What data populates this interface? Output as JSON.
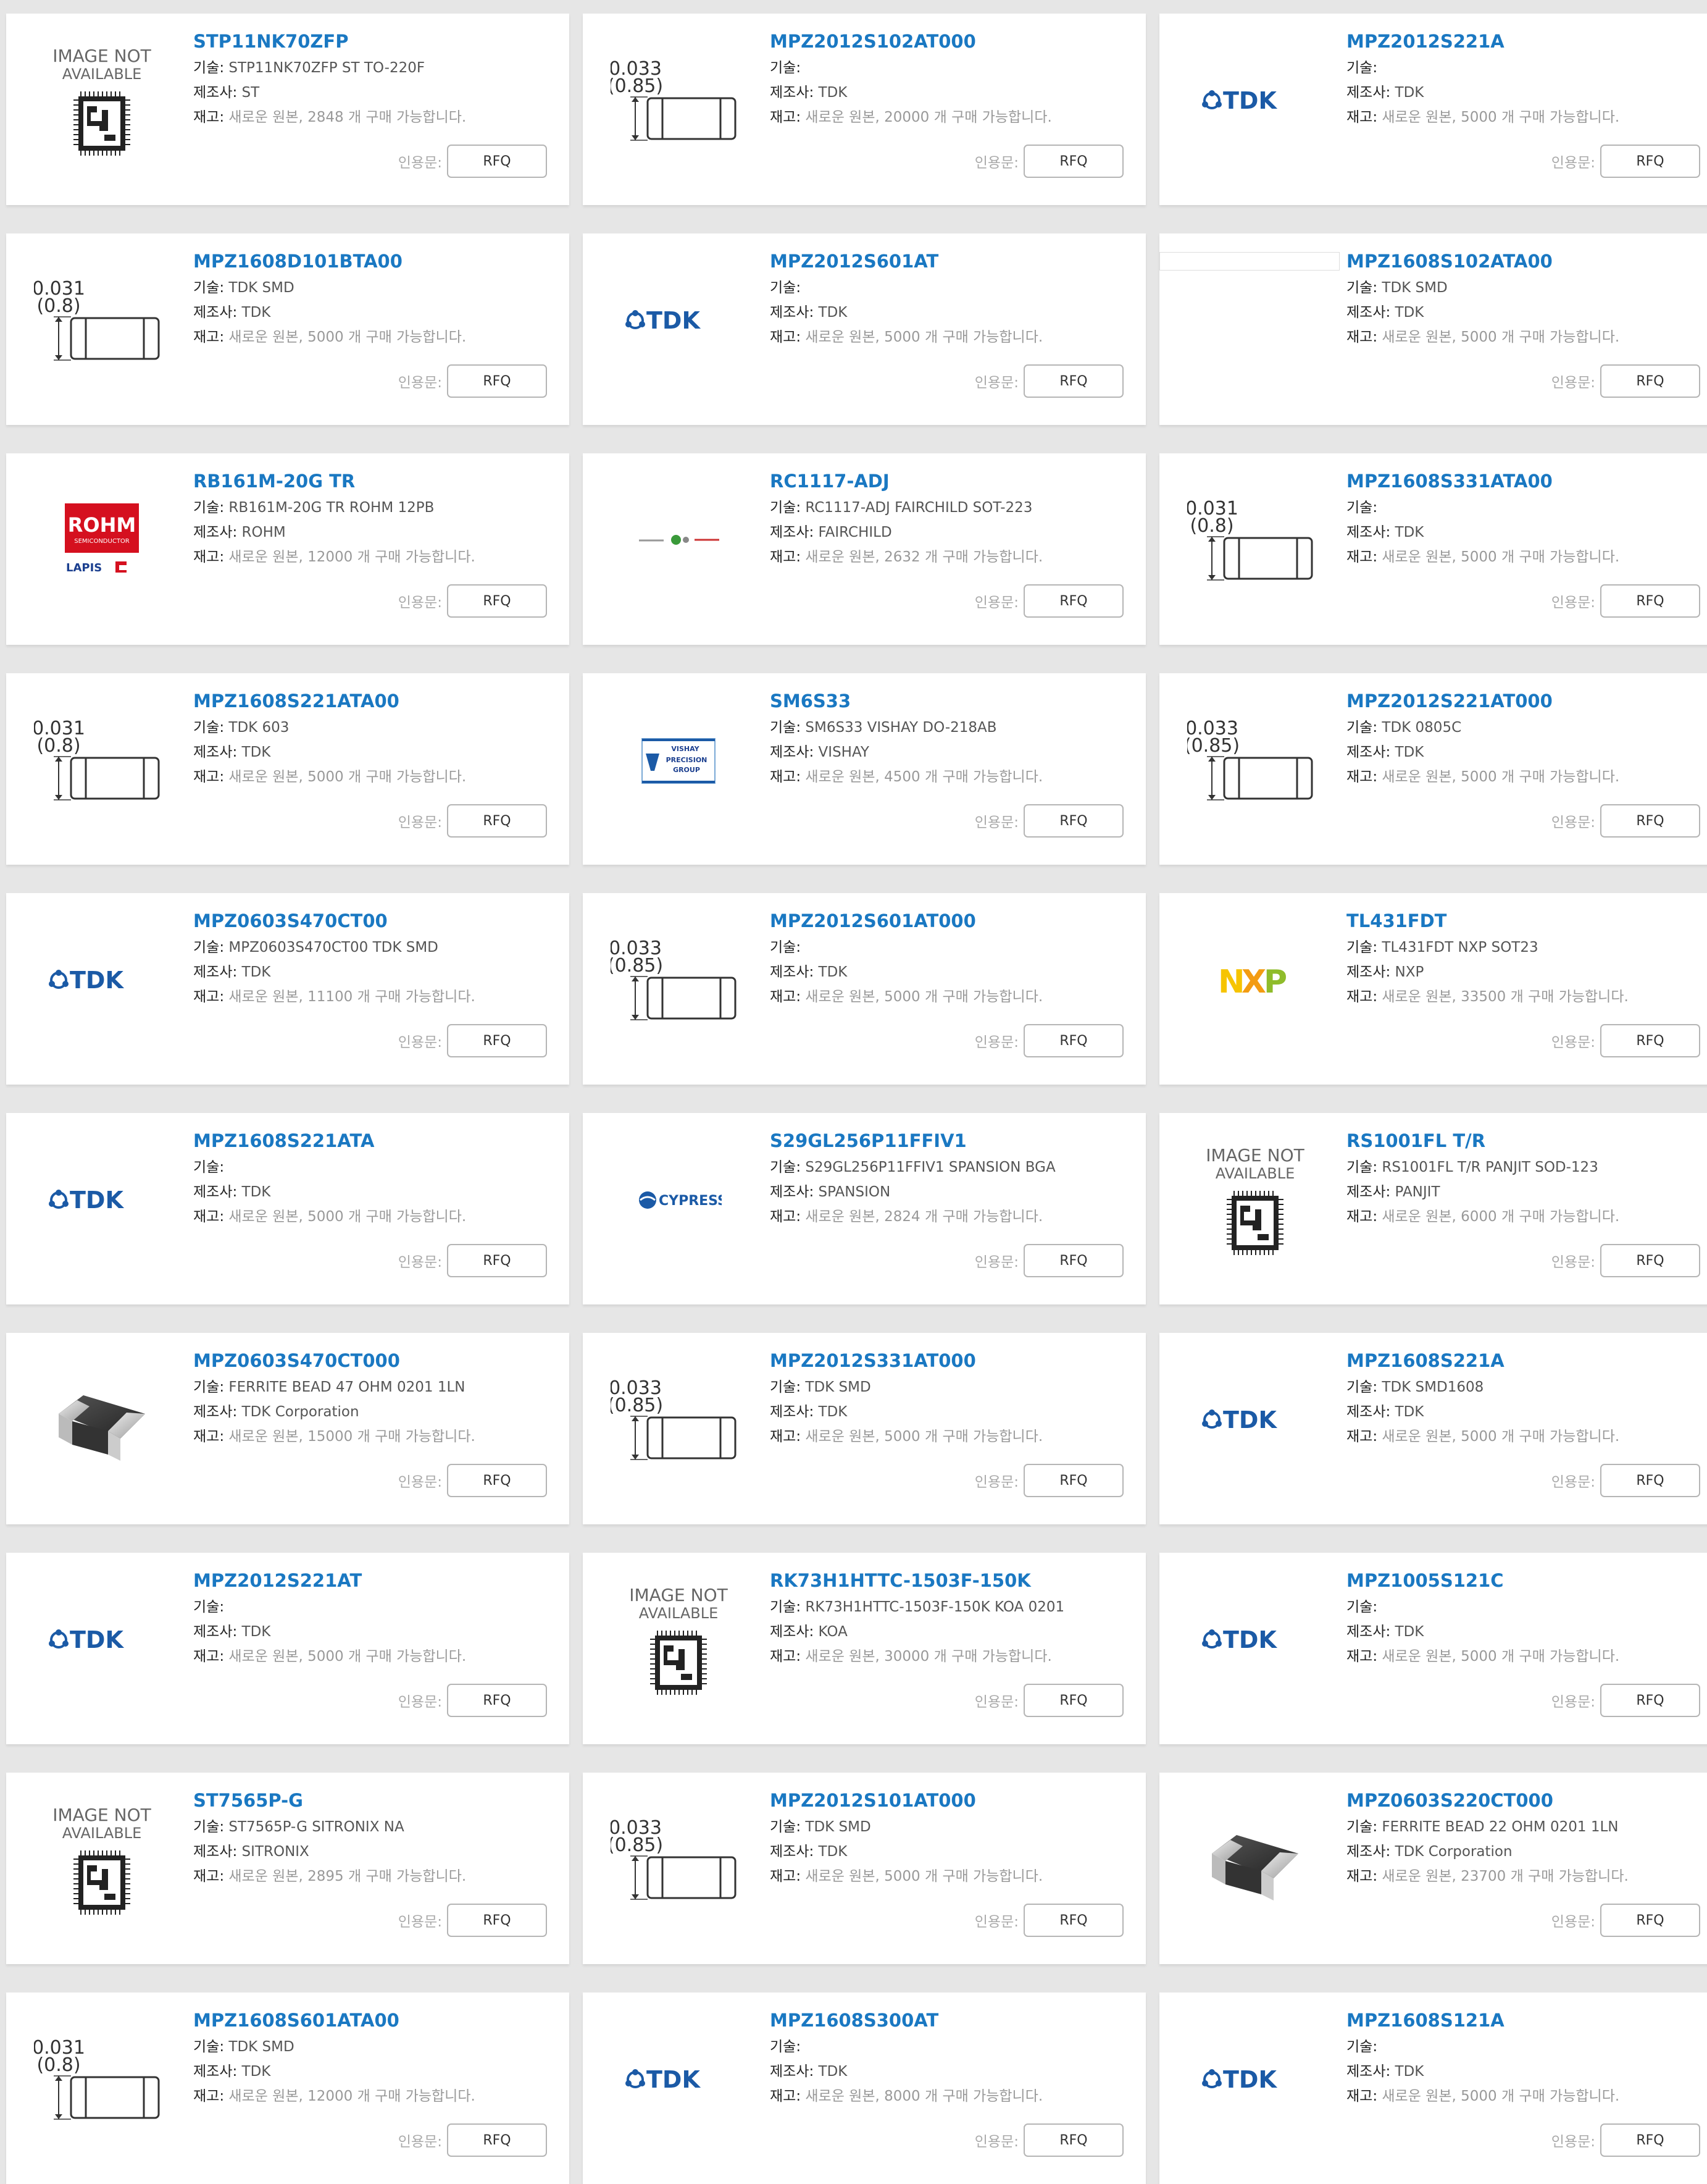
{
  "labels": {
    "tech": "기술:",
    "mfr": "제조사:",
    "stock": "재고:",
    "quote": "인용문:"
  },
  "products": [
    {
      "name": "STP11NK70ZFP",
      "tech": "STP11NK70ZFP ST TO-220F",
      "mfr": "ST",
      "stock": "새로운 원본, 2848 개 구매 가능합니다.",
      "rfq": "RFQ",
      "img": "noimage"
    },
    {
      "name": "MPZ2012S102AT000",
      "tech": "",
      "mfr": "TDK",
      "stock": "새로운 원본, 20000 개 구매 가능합니다.",
      "rfq": "RFQ",
      "img": "dim085"
    },
    {
      "name": "MPZ2012S221A",
      "tech": "",
      "mfr": "TDK",
      "stock": "새로운 원본, 5000 개 구매 가능합니다.",
      "rfq": "RFQ",
      "img": "tdk"
    },
    {
      "name": "MPZ1608D101BTA00",
      "tech": "TDK SMD",
      "mfr": "TDK",
      "stock": "새로운 원본, 5000 개 구매 가능합니다.",
      "rfq": "RFQ",
      "img": "dim08"
    },
    {
      "name": "MPZ2012S601AT",
      "tech": "",
      "mfr": "TDK",
      "stock": "새로운 원본, 5000 개 구매 가능합니다.",
      "rfq": "RFQ",
      "img": "tdk"
    },
    {
      "name": "MPZ1608S102ATA00",
      "tech": "TDK SMD",
      "mfr": "TDK",
      "stock": "새로운 원본, 5000 개 구매 가능합니다.",
      "rfq": "RFQ",
      "img": "blank"
    },
    {
      "name": "RB161M-20G TR",
      "tech": "RB161M-20G TR ROHM 12PB",
      "mfr": "ROHM",
      "stock": "새로운 원본, 12000 개 구매 가능합니다.",
      "rfq": "RFQ",
      "img": "rohm"
    },
    {
      "name": "RC1117-ADJ",
      "tech": "RC1117-ADJ FAIRCHILD SOT-223",
      "mfr": "FAIRCHILD",
      "stock": "새로운 원본, 2632 개 구매 가능합니다.",
      "rfq": "RFQ",
      "img": "fairchild"
    },
    {
      "name": "MPZ1608S331ATA00",
      "tech": "",
      "mfr": "TDK",
      "stock": "새로운 원본, 5000 개 구매 가능합니다.",
      "rfq": "RFQ",
      "img": "dim08"
    },
    {
      "name": "MPZ1608S221ATA00",
      "tech": "TDK 603",
      "mfr": "TDK",
      "stock": "새로운 원본, 5000 개 구매 가능합니다.",
      "rfq": "RFQ",
      "img": "dim08"
    },
    {
      "name": "SM6S33",
      "tech": "SM6S33 VISHAY DO-218AB",
      "mfr": "VISHAY",
      "stock": "새로운 원본, 4500 개 구매 가능합니다.",
      "rfq": "RFQ",
      "img": "vishay"
    },
    {
      "name": "MPZ2012S221AT000",
      "tech": "TDK 0805C",
      "mfr": "TDK",
      "stock": "새로운 원본, 5000 개 구매 가능합니다.",
      "rfq": "RFQ",
      "img": "dim085"
    },
    {
      "name": "MPZ0603S470CT00",
      "tech": "MPZ0603S470CT00 TDK SMD",
      "mfr": "TDK",
      "stock": "새로운 원본, 11100 개 구매 가능합니다.",
      "rfq": "RFQ",
      "img": "tdk"
    },
    {
      "name": "MPZ2012S601AT000",
      "tech": "",
      "mfr": "TDK",
      "stock": "새로운 원본, 5000 개 구매 가능합니다.",
      "rfq": "RFQ",
      "img": "dim085"
    },
    {
      "name": "TL431FDT",
      "tech": "TL431FDT NXP SOT23",
      "mfr": "NXP",
      "stock": "새로운 원본, 33500 개 구매 가능합니다.",
      "rfq": "RFQ",
      "img": "nxp"
    },
    {
      "name": "MPZ1608S221ATA",
      "tech": "",
      "mfr": "TDK",
      "stock": "새로운 원본, 5000 개 구매 가능합니다.",
      "rfq": "RFQ",
      "img": "tdk"
    },
    {
      "name": "S29GL256P11FFIV1",
      "tech": "S29GL256P11FFIV1 SPANSION BGA",
      "mfr": "SPANSION",
      "stock": "새로운 원본, 2824 개 구매 가능합니다.",
      "rfq": "RFQ",
      "img": "cypress"
    },
    {
      "name": "RS1001FL T/R",
      "tech": "RS1001FL T/R PANJIT SOD-123",
      "mfr": "PANJIT",
      "stock": "새로운 원본, 6000 개 구매 가능합니다.",
      "rfq": "RFQ",
      "img": "noimage"
    },
    {
      "name": "MPZ0603S470CT000",
      "tech": "FERRITE BEAD 47 OHM 0201 1LN",
      "mfr": "TDK Corporation",
      "stock": "새로운 원본, 15000 개 구매 가능합니다.",
      "rfq": "RFQ",
      "img": "bead"
    },
    {
      "name": "MPZ2012S331AT000",
      "tech": "TDK SMD",
      "mfr": "TDK",
      "stock": "새로운 원본, 5000 개 구매 가능합니다.",
      "rfq": "RFQ",
      "img": "dim085"
    },
    {
      "name": "MPZ1608S221A",
      "tech": "TDK SMD1608",
      "mfr": "TDK",
      "stock": "새로운 원본, 5000 개 구매 가능합니다.",
      "rfq": "RFQ",
      "img": "tdk"
    },
    {
      "name": "MPZ2012S221AT",
      "tech": "",
      "mfr": "TDK",
      "stock": "새로운 원본, 5000 개 구매 가능합니다.",
      "rfq": "RFQ",
      "img": "tdk"
    },
    {
      "name": "RK73H1HTTC-1503F-150K",
      "tech": "RK73H1HTTC-1503F-150K KOA 0201",
      "mfr": "KOA",
      "stock": "새로운 원본, 30000 개 구매 가능합니다.",
      "rfq": "RFQ",
      "img": "noimage"
    },
    {
      "name": "MPZ1005S121C",
      "tech": "",
      "mfr": "TDK",
      "stock": "새로운 원본, 5000 개 구매 가능합니다.",
      "rfq": "RFQ",
      "img": "tdk"
    },
    {
      "name": "ST7565P-G",
      "tech": "ST7565P-G SITRONIX NA",
      "mfr": "SITRONIX",
      "stock": "새로운 원본, 2895 개 구매 가능합니다.",
      "rfq": "RFQ",
      "img": "noimage"
    },
    {
      "name": "MPZ2012S101AT000",
      "tech": "TDK SMD",
      "mfr": "TDK",
      "stock": "새로운 원본, 5000 개 구매 가능합니다.",
      "rfq": "RFQ",
      "img": "dim085"
    },
    {
      "name": "MPZ0603S220CT000",
      "tech": "FERRITE BEAD 22 OHM 0201 1LN",
      "mfr": "TDK Corporation",
      "stock": "새로운 원본, 23700 개 구매 가능합니다.",
      "rfq": "RFQ",
      "img": "bead"
    },
    {
      "name": "MPZ1608S601ATA00",
      "tech": "TDK SMD",
      "mfr": "TDK",
      "stock": "새로운 원본, 12000 개 구매 가능합니다.",
      "rfq": "RFQ",
      "img": "dim08"
    },
    {
      "name": "MPZ1608S300AT",
      "tech": "",
      "mfr": "TDK",
      "stock": "새로운 원본, 8000 개 구매 가능합니다.",
      "rfq": "RFQ",
      "img": "tdk"
    },
    {
      "name": "MPZ1608S121A",
      "tech": "",
      "mfr": "TDK",
      "stock": "새로운 원본, 5000 개 구매 가능합니다.",
      "rfq": "RFQ",
      "img": "tdk"
    }
  ],
  "image_text": {
    "noimage": [
      "IMAGE NOT",
      "AVAILABLE"
    ],
    "tdk": "TDK",
    "rohm": [
      "ROHM",
      "SEMICONDUCTOR",
      "LAPIS"
    ],
    "vishay": [
      "VISHAY",
      "PRECISION",
      "GROUP"
    ],
    "cypress": "CYPRESS",
    "nxp": [
      "N",
      "X",
      "P"
    ],
    "dim08": [
      "0.031",
      "(0.8)"
    ],
    "dim085": [
      "0.033",
      "(0.85)"
    ]
  },
  "colors": {
    "link": "#1a78c2",
    "rohm_red": "#d5101f",
    "tdk_blue": "#1b5aa6",
    "nxp_yellow": "#f6c400",
    "nxp_green": "#8fbc2b"
  }
}
